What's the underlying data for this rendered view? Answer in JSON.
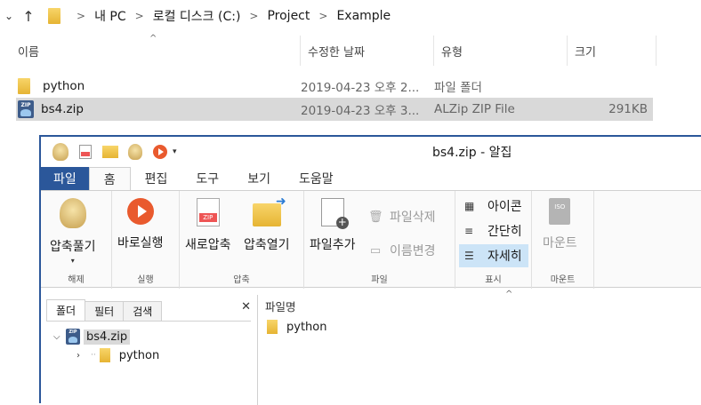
{
  "explorer": {
    "breadcrumb": [
      "내 PC",
      "로컬 디스크 (C:)",
      "Project",
      "Example"
    ],
    "columns": {
      "name": "이름",
      "date": "수정한 날짜",
      "type": "유형",
      "size": "크기"
    },
    "files": [
      {
        "name": "python",
        "date": "2019-04-23 오후 2...",
        "type": "파일 폴더",
        "size": "",
        "icon": "folder-icon"
      },
      {
        "name": "bs4.zip",
        "date": "2019-04-23 오후 3...",
        "type": "ALZip ZIP File",
        "size": "291KB",
        "icon": "zip-icon"
      }
    ]
  },
  "alzip": {
    "title": "bs4.zip - 알집",
    "tabs": [
      "파일",
      "홈",
      "편집",
      "도구",
      "보기",
      "도움말"
    ],
    "active_tab": "홈",
    "groups": {
      "extract": {
        "label": "해제",
        "button": "압축풀기"
      },
      "run": {
        "label": "실행",
        "button": "바로실행"
      },
      "compress": {
        "label": "압축",
        "new": "새로압축",
        "open": "압축열기"
      },
      "file": {
        "label": "파일",
        "add": "파일추가",
        "delete": "파일삭제",
        "rename": "이름변경"
      },
      "view": {
        "label": "표시",
        "icons": "아이콘",
        "simple": "간단히",
        "details": "자세히"
      },
      "mount": {
        "label": "마운트",
        "button": "마운트",
        "icon_text": "ISO"
      }
    },
    "tree": {
      "tabs": [
        "폴더",
        "필터",
        "검색"
      ],
      "root": "bs4.zip",
      "child": "python"
    },
    "list": {
      "header": "파일명",
      "items": [
        "python"
      ]
    },
    "zip_icon_text": "ZIP",
    "colors": {
      "accent": "#2b579a",
      "selected_view": "#cce4f7",
      "folder": "#e6b433"
    }
  }
}
